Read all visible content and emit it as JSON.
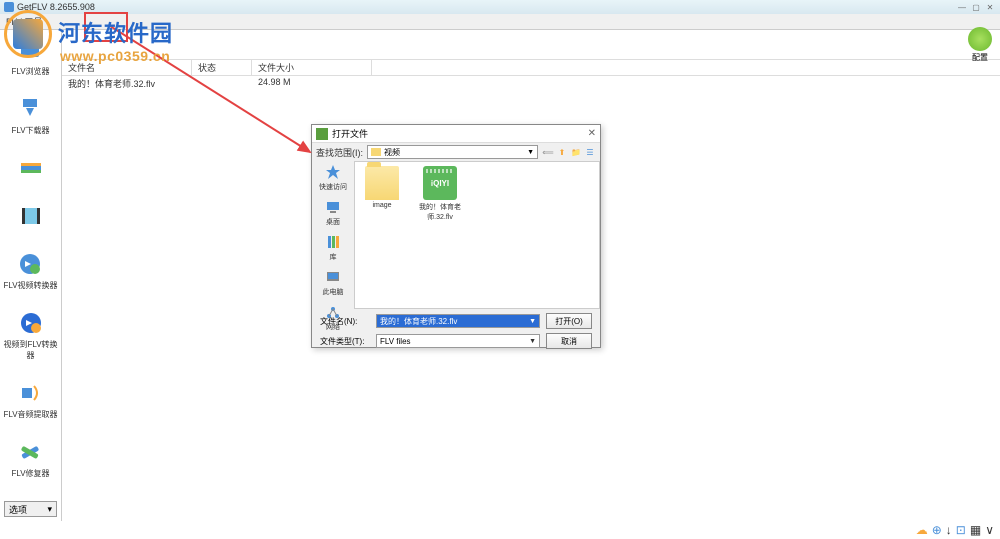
{
  "titlebar": {
    "title": "GetFLV 8.2655.908"
  },
  "menubar": {
    "label": "FLV 工具"
  },
  "toolbar": {
    "config_label": "配置"
  },
  "headers": {
    "name": "文件名",
    "status": "状态",
    "size": "文件大小"
  },
  "row": {
    "name": "我的！体育老师.32.flv",
    "status": "",
    "size": "24.98 M"
  },
  "sidebar": {
    "items": [
      {
        "label": "FLV浏览器"
      },
      {
        "label": "FLV下载器"
      },
      {
        "label": ""
      },
      {
        "label": ""
      },
      {
        "label": "FLV视频转换器"
      },
      {
        "label": "视频到FLV转换器"
      },
      {
        "label": "FLV音频提取器"
      },
      {
        "label": "FLV修复器"
      }
    ],
    "options": "选项"
  },
  "dialog": {
    "title": "打开文件",
    "look_in": "查找范围(I):",
    "path": "视频",
    "places": {
      "quick": "快速访问",
      "desktop": "桌面",
      "libs": "库",
      "pc": "此电脑",
      "net": "网络"
    },
    "files": [
      {
        "name": "image",
        "type": "folder"
      },
      {
        "name": "我的！体育老师.32.flv",
        "type": "flv"
      }
    ],
    "filename_label": "文件名(N):",
    "filename_value": "我的！体育老师.32.flv",
    "filetype_label": "文件类型(T):",
    "filetype_value": "FLV files",
    "open_btn": "打开(O)",
    "cancel_btn": "取消"
  },
  "watermark": {
    "site_name": "河东软件园",
    "url": "www.pc0359.cn",
    "center": "w w w . p c 0 3 5 9 . c n"
  }
}
